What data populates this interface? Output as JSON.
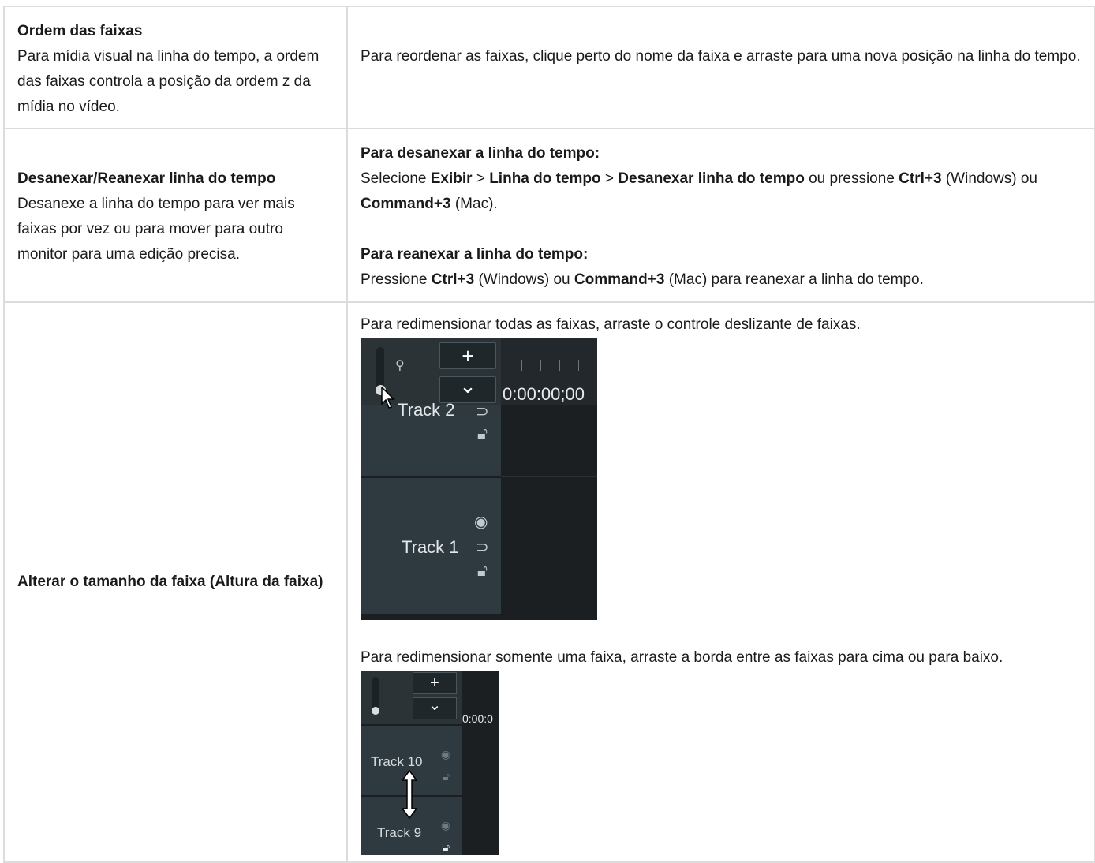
{
  "rows": [
    {
      "title": "Ordem das faixas",
      "desc": "Para mídia visual na linha do tempo, a ordem das faixas controla a posição da ordem z da mídia no vídeo.",
      "text": "Para reordenar as faixas, clique perto do nome da faixa e arraste para uma nova posição na linha do tempo."
    },
    {
      "title": "Desanexar/Reanexar linha do tempo",
      "desc": "Desanexe a linha do tempo para ver mais faixas por vez ou para mover para outro monitor para uma edição precisa.",
      "detach_heading": "Para desanexar a linha do tempo:",
      "detach_parts": [
        "Selecione ",
        "Exibir",
        " > ",
        "Linha do tempo",
        " > ",
        "Desanexar linha do tempo",
        " ou pressione ",
        "Ctrl+3",
        " (Windows) ou ",
        "Command+3",
        " (Mac)."
      ],
      "reattach_heading": "Para reanexar a linha do tempo:",
      "reattach_parts": [
        "Pressione ",
        "Ctrl+3",
        " (Windows) ou ",
        "Command+3",
        " (Mac) para reanexar a linha do tempo."
      ]
    },
    {
      "title": "Alterar o tamanho da faixa (Altura da faixa)",
      "all_tracks_text": "Para redimensionar todas as faixas, arraste o controle deslizante de faixas.",
      "one_track_text": "Para redimensionar somente uma faixa, arraste a borda entre as faixas para cima ou para baixo."
    }
  ],
  "screenshot1": {
    "timecode": "0:00:00;00",
    "track_top": "Track 2",
    "track_bottom": "Track 1",
    "plus": "+",
    "chevron": "⌄"
  },
  "screenshot2": {
    "timecode": "0:00:0",
    "track_top": "Track 10",
    "track_bottom": "Track 9",
    "plus": "+",
    "chevron": "⌄"
  }
}
